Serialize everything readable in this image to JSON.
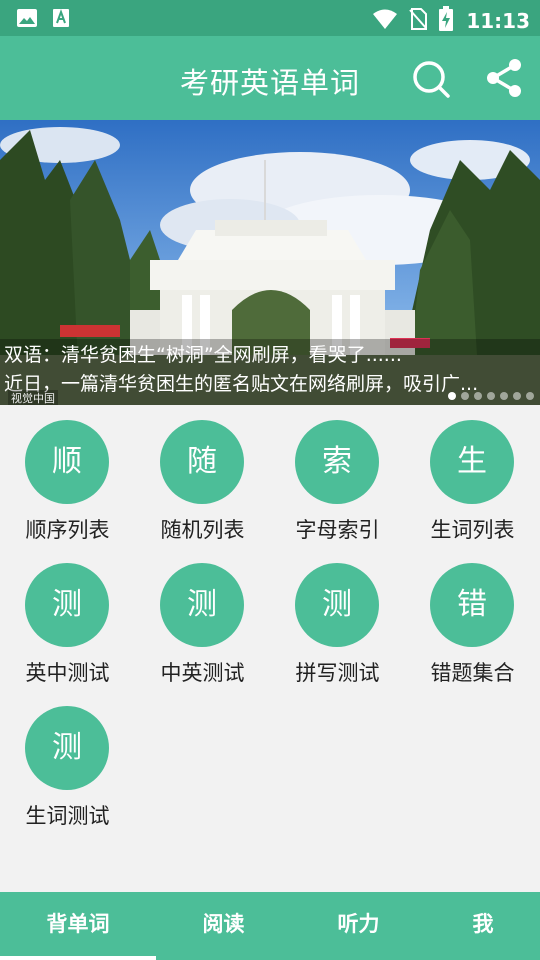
{
  "status_bar": {
    "time": "11:13",
    "icons": [
      "image-icon",
      "app-a-icon",
      "wifi-icon",
      "no-sim-icon",
      "battery-charging-icon"
    ]
  },
  "app_bar": {
    "title": "考研英语单词",
    "icons": [
      "search-icon",
      "share-icon"
    ]
  },
  "banner": {
    "line1": "双语：清华贫困生“树洞”全网刷屏，看哭了......",
    "line2": "近日，一篇清华贫困生的匿名贴文在网络刷屏，吸引广...",
    "watermark": "视觉中国",
    "page_count": 7,
    "active_page": 1
  },
  "menu": [
    {
      "glyph": "顺",
      "label": "顺序列表"
    },
    {
      "glyph": "随",
      "label": "随机列表"
    },
    {
      "glyph": "索",
      "label": "字母索引"
    },
    {
      "glyph": "生",
      "label": "生词列表"
    },
    {
      "glyph": "测",
      "label": "英中测试"
    },
    {
      "glyph": "测",
      "label": "中英测试"
    },
    {
      "glyph": "测",
      "label": "拼写测试"
    },
    {
      "glyph": "错",
      "label": "错题集合"
    },
    {
      "glyph": "测",
      "label": "生词测试"
    }
  ],
  "bottom_nav": {
    "tabs": [
      "背单词",
      "阅读",
      "听力",
      "我"
    ],
    "active": 0
  },
  "colors": {
    "accent": "#4cbe98",
    "status_bar": "#3aa57f",
    "background": "#f2f2f2"
  }
}
